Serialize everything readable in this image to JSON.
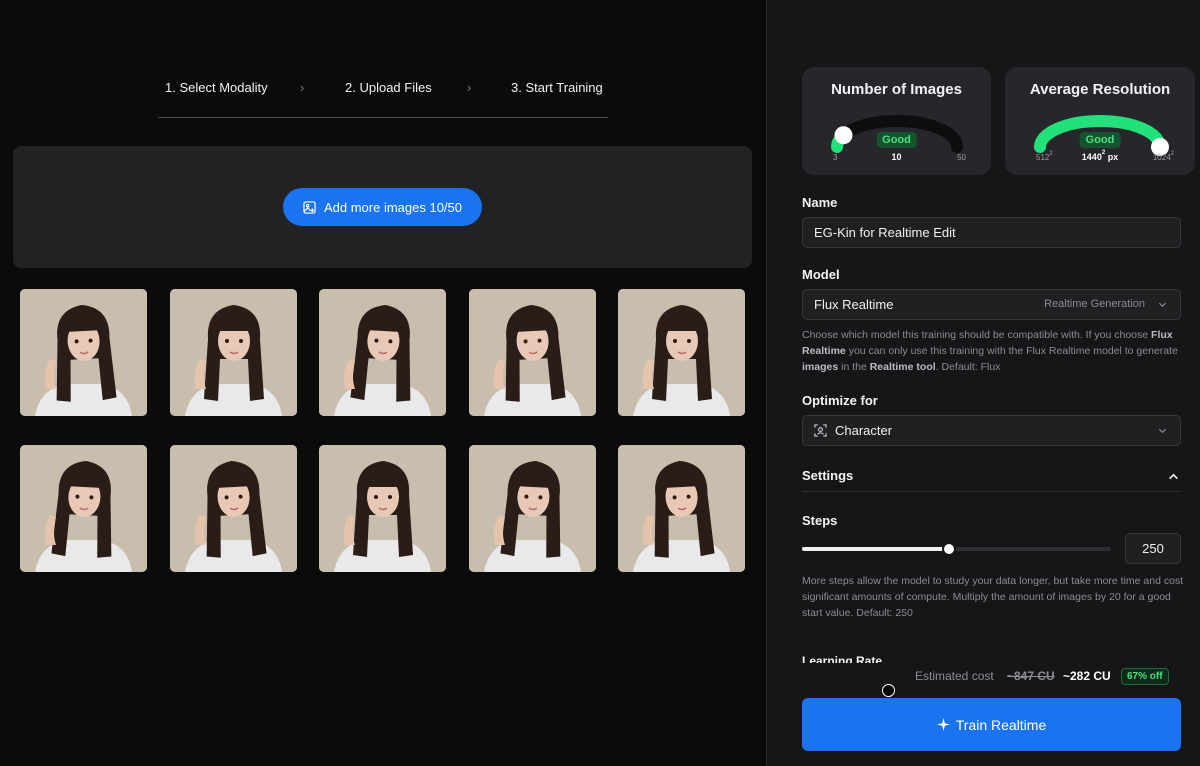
{
  "stepper": {
    "steps": [
      "1. Select Modality",
      "2. Upload Files",
      "3. Start Training"
    ],
    "separator": "›"
  },
  "upload": {
    "add_button_label": "Add more images 10/50",
    "add_button_icon": "image-add-icon",
    "image_count": 10
  },
  "gauges": {
    "images": {
      "title": "Number of Images",
      "status": "Good",
      "value": "10",
      "min": "3",
      "max": "50",
      "fraction": 0.15
    },
    "resolution": {
      "title": "Average Resolution",
      "status": "Good",
      "value": "1440",
      "value_unit": "px",
      "min": "512",
      "max": "1024",
      "fraction": 1.0
    }
  },
  "form": {
    "name_label": "Name",
    "name_value": "EG-Kin for Realtime Edit",
    "model_label": "Model",
    "model_value": "Flux Realtime",
    "model_hint": "Realtime Generation",
    "model_help_1": "Choose which model this training should be compatible with. If you choose ",
    "model_help_b1": "Flux Realtime",
    "model_help_2": " you can only use this training with the Flux Realtime model to generate ",
    "model_help_b2": "images",
    "model_help_3": " in the ",
    "model_help_b3": "Realtime tool",
    "model_help_4": ". Default: Flux",
    "optimize_label": "Optimize for",
    "optimize_value": "Character",
    "optimize_icon": "face-scan-icon",
    "settings_label": "Settings",
    "steps_label": "Steps",
    "steps_value": "250",
    "steps_fraction": 0.475,
    "steps_help": "More steps allow the model to study your data longer, but take more time and cost significant amounts of compute. Multiply the amount of images by 20 for a good start value. Default: 250",
    "learning_rate_label": "Learning Rate"
  },
  "cost": {
    "label": "Estimated cost",
    "old": "~847 CU",
    "new": "~282 CU",
    "discount": "67% off"
  },
  "train_button_label": "Train Realtime",
  "colors": {
    "accent": "#1a73f0",
    "good": "#22e07a"
  }
}
